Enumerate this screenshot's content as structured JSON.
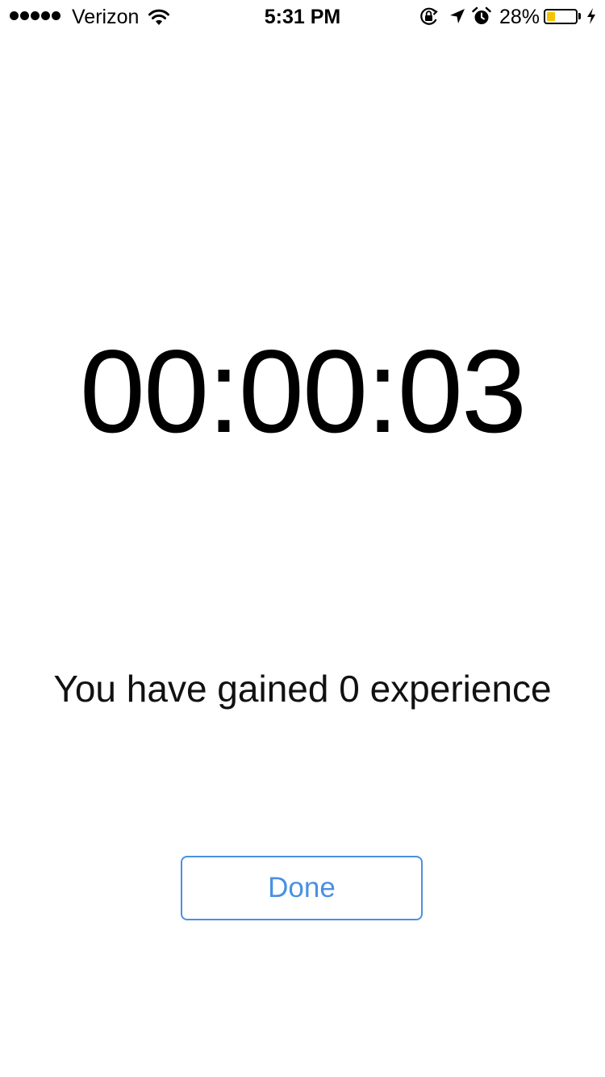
{
  "status_bar": {
    "signal_bars": 5,
    "carrier": "Verizon",
    "time": "5:31 PM",
    "battery_percent_label": "28%",
    "battery_level": 0.28,
    "battery_color": "#f4c400",
    "icons": [
      "wifi-icon",
      "rotation-lock-icon",
      "location-arrow-icon",
      "alarm-clock-icon",
      "battery-icon",
      "charging-bolt-icon"
    ]
  },
  "main": {
    "timer": "00:00:03",
    "experience_text": "You have gained 0 experience",
    "done_label": "Done",
    "accent_color": "#4a90e2"
  }
}
